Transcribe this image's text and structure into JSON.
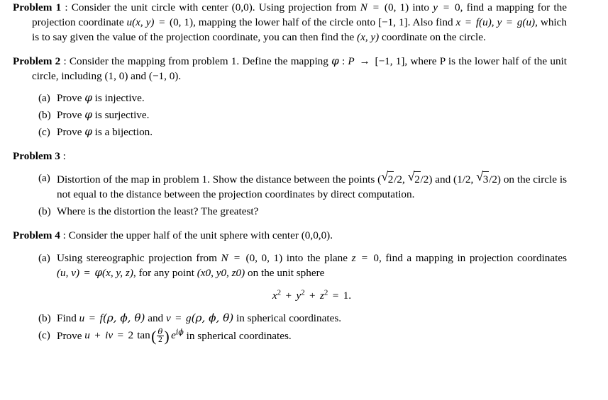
{
  "document": {
    "type": "math-problem-set",
    "background_color": "#ffffff",
    "text_color": "#000000",
    "problems": [
      {
        "id": "problem-1",
        "label": "Problem 1",
        "separator": " : ",
        "body_segments": [
          {
            "t": "text",
            "v": "Consider the unit circle with center (0,0). Using projection from "
          },
          {
            "t": "math",
            "v": "N = (0, 1)"
          },
          {
            "t": "text",
            "v": " into "
          },
          {
            "t": "math",
            "v": "y = 0"
          },
          {
            "t": "text",
            "v": ", find a mapping for the projection coordinate "
          },
          {
            "t": "math",
            "v": "u(x, y) = (0, 1)"
          },
          {
            "t": "text",
            "v": ", mapping the lower half of the circle onto "
          },
          {
            "t": "math",
            "v": "[-1, 1]"
          },
          {
            "t": "text",
            "v": ". Also find "
          },
          {
            "t": "math",
            "v": "x = f(u), y = g(u)"
          },
          {
            "t": "text",
            "v": ", which is to say given the value of the projection coordinate, you can then find the "
          },
          {
            "t": "math",
            "v": "(x, y)"
          },
          {
            "t": "text",
            "v": " coordinate on the circle."
          }
        ],
        "plain_text": "Consider the unit circle with center (0,0). Using projection from N = (0, 1) into y = 0, find a mapping for the projection coordinate u(x, y) = (0, 1), mapping the lower half of the circle onto [-1, 1]. Also find x = f(u), y = g(u), which is to say given the value of the projection coordinate, you can then find the (x, y) coordinate on the circle.",
        "items": []
      },
      {
        "id": "problem-2",
        "label": "Problem 2",
        "separator": " : ",
        "plain_text": "Consider the mapping from problem 1. Define the mapping φ : P → [−1, 1], where P is the lower half of the unit circle, including (1, 0) and (−1, 0).",
        "items": [
          {
            "marker": "(a)",
            "text": "Prove φ is injective."
          },
          {
            "marker": "(b)",
            "text": "Prove φ is surjective."
          },
          {
            "marker": "(c)",
            "text": "Prove φ is a bijection."
          }
        ]
      },
      {
        "id": "problem-3",
        "label": "Problem 3",
        "separator": " :",
        "plain_text": "",
        "items": [
          {
            "marker": "(a)",
            "text": "Distortion of the map in problem 1. Show the distance between the points (√2/2, √2/2) and (1/2, √3/2) on the circle is not equal to the distance between the projection coordinates by direct computation."
          },
          {
            "marker": "(b)",
            "text": "Where is the distortion the least? The greatest?"
          }
        ]
      },
      {
        "id": "problem-4",
        "label": "Problem 4",
        "separator": " : ",
        "plain_text": "Consider the upper half of the unit sphere with center (0,0,0).",
        "items": [
          {
            "marker": "(a)",
            "text": "Using stereographic projection from N = (0, 0, 1) into the plane z = 0, find a mapping in projection coordinates (u, v) = φ(x, y, z), for any point (x0, y0, z0) on the unit sphere",
            "display_equation": "x² + y² + z² = 1."
          },
          {
            "marker": "(b)",
            "text": "Find u = f(ρ, ϕ, θ) and v = g(ρ, ϕ, θ) in spherical coordinates."
          },
          {
            "marker": "(c)",
            "text": "Prove u + iv = 2 tan (θ/2) e^{iϕ} in spherical coordinates."
          }
        ]
      }
    ],
    "p1": {
      "label": "Problem 1",
      "sep": " : ",
      "s1": "Consider the unit circle with center (0,0). Using projection from ",
      "m_N": "N",
      "m_N_eq": " = ",
      "m_N_val": "(0, 1)",
      "s2": " into ",
      "m_y": "y",
      "m_y_eq": " = ",
      "m_y_val": "0",
      "s3": ", find a mapping for the projection coordinate ",
      "m_u": "u",
      "m_u_args": "(x, y)",
      "m_u_eq": " = ",
      "m_u_val": "(0, 1)",
      "s4": ", mapping the lower half of the circle onto ",
      "m_interval": "[−1, 1]",
      "s5": ". Also find ",
      "m_x": "x",
      "m_x_eq": " = ",
      "m_f": "f",
      "m_f_arg": "(u),",
      "m_y2": " y",
      "m_y2_eq": " = ",
      "m_g": "g",
      "m_g_arg": "(u)",
      "s6": ", which is to say given the value of the projection coordinate, you can then find the ",
      "m_xy": "(x, y)",
      "s7": " coordinate on the circle."
    },
    "p2": {
      "label": "Problem 2",
      "sep": " : ",
      "s1": "Consider the mapping from problem 1. Define the mapping ",
      "m_phi": "φ",
      "m_colon": " : ",
      "m_P": "P",
      "m_arrow": " → ",
      "m_interval": "[−1, 1]",
      "s2": ", where P is the lower half of the unit circle, including (1, 0) and (−1, 0).",
      "items": [
        {
          "marker": "(a)",
          "pre": "Prove ",
          "sym": "φ",
          "post": " is injective."
        },
        {
          "marker": "(b)",
          "pre": "Prove ",
          "sym": "φ",
          "post": " is surjective."
        },
        {
          "marker": "(c)",
          "pre": "Prove ",
          "sym": "φ",
          "post": " is a bijection."
        }
      ]
    },
    "p3": {
      "label": "Problem 3",
      "sep": " :",
      "a_marker": "(a)",
      "a_s1": "Distortion of the map in problem 1. Show the distance between the points (",
      "a_r1": "2",
      "a_s2": "/2, ",
      "a_r2": "2",
      "a_s3": "/2) and (1/2, ",
      "a_r3": "3",
      "a_s4": "/2) on the circle is not equal to the distance between the projection coordinates by direct computation.",
      "b_marker": "(b)",
      "b_text": "Where is the distortion the least? The greatest?"
    },
    "p4": {
      "label": "Problem 4",
      "sep": " : ",
      "s1": "Consider the upper half of the unit sphere with center (0,0,0).",
      "a_marker": "(a)",
      "a_s1": "Using stereographic projection from ",
      "a_N": "N",
      "a_N_eq": " = ",
      "a_N_val": "(0, 0, 1)",
      "a_s2": " into the plane ",
      "a_z": "z",
      "a_z_eq": " = ",
      "a_z_val": "0",
      "a_s3": ", find a mapping in projection coordinates ",
      "a_uv": "(u, v)",
      "a_uv_eq": " = ",
      "a_phi": "φ",
      "a_phi_args": "(x, y, z)",
      "a_s4": ", for any point ",
      "a_pt": "(x0, y0, z0)",
      "a_s5": " on the unit sphere",
      "eq_x": "x",
      "eq_sup": "2",
      "eq_plus": " + ",
      "eq_y": "y",
      "eq_z": "z",
      "eq_rel": " = ",
      "eq_rhs": "1.",
      "b_marker": "(b)",
      "b_s1": "Find ",
      "b_u": "u",
      "b_eq": " = ",
      "b_f": "f",
      "b_fargs": "(ρ, ϕ, θ)",
      "b_s2": " and ",
      "b_v": "v",
      "b_eq2": " = ",
      "b_g": "g",
      "b_gargs": "(ρ, ϕ, θ)",
      "b_s3": " in spherical coordinates.",
      "c_marker": "(c)",
      "c_s1": "Prove ",
      "c_u": "u",
      "c_plus": " + ",
      "c_iv": "iv",
      "c_eq": " = ",
      "c_two": "2 ",
      "c_tan": "tan",
      "c_num": "θ",
      "c_den": "2",
      "c_e": "e",
      "c_esup": "iϕ",
      "c_s2": " in spherical coordinates."
    }
  }
}
